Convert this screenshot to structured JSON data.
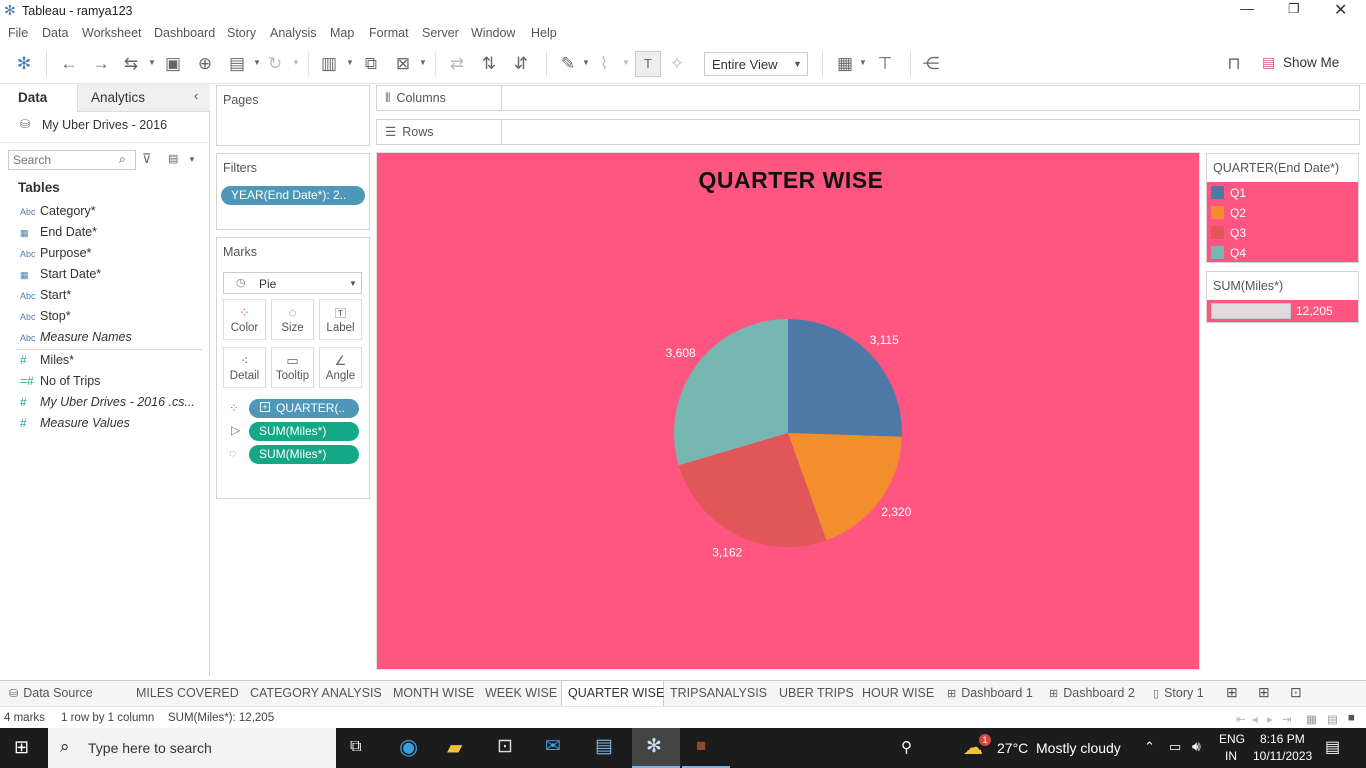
{
  "window": {
    "title": "Tableau - ramya123"
  },
  "menu": [
    "File",
    "Data",
    "Worksheet",
    "Dashboard",
    "Story",
    "Analysis",
    "Map",
    "Format",
    "Server",
    "Window",
    "Help"
  ],
  "toolbar": {
    "view_select": "Entire View",
    "show_me": "Show Me"
  },
  "left_panel": {
    "tab_data": "Data",
    "tab_analytics": "Analytics",
    "datasource": "My Uber Drives - 2016",
    "search_placeholder": "Search",
    "tables_header": "Tables",
    "fields": [
      {
        "name": "Category*",
        "icon": "Abc",
        "italic": false
      },
      {
        "name": "End Date*",
        "icon": "date",
        "italic": false
      },
      {
        "name": "Purpose*",
        "icon": "Abc",
        "italic": false
      },
      {
        "name": "Start Date*",
        "icon": "date",
        "italic": false
      },
      {
        "name": "Start*",
        "icon": "Abc",
        "italic": false
      },
      {
        "name": "Stop*",
        "icon": "Abc",
        "italic": false
      },
      {
        "name": "Measure Names",
        "icon": "Abc",
        "italic": true
      },
      {
        "name": "Miles*",
        "icon": "#",
        "italic": false
      },
      {
        "name": "No of Trips",
        "icon": "=#",
        "italic": false
      },
      {
        "name": "My Uber Drives - 2016 .cs...",
        "icon": "#",
        "italic": true
      },
      {
        "name": "Measure Values",
        "icon": "#",
        "italic": true
      }
    ]
  },
  "pages": {
    "title": "Pages"
  },
  "filters": {
    "title": "Filters",
    "pill": "YEAR(End Date*): 2.."
  },
  "marks": {
    "title": "Marks",
    "type": "Pie",
    "buttons": [
      "Color",
      "Size",
      "Label",
      "Detail",
      "Tooltip",
      "Angle"
    ],
    "pills": [
      {
        "label": "QUARTER(..",
        "color": "#4f97b8"
      },
      {
        "label": "SUM(Miles*)",
        "color": "#14a887"
      },
      {
        "label": "SUM(Miles*)",
        "color": "#14a887"
      }
    ]
  },
  "shelves": {
    "columns": "Columns",
    "rows": "Rows"
  },
  "viz": {
    "title": "QUARTER WISE",
    "background": "#fe5680"
  },
  "chart_data": {
    "type": "pie",
    "title": "QUARTER WISE",
    "categories": [
      "Q1",
      "Q2",
      "Q3",
      "Q4"
    ],
    "values": [
      3115,
      2320,
      3162,
      3608
    ],
    "value_labels": [
      "3,115",
      "2,320",
      "3,162",
      "3,608"
    ],
    "colors": [
      "#4e79a7",
      "#f28e2b",
      "#e15759",
      "#76b7b2"
    ],
    "legend_position": "right"
  },
  "legend_color": {
    "title": "QUARTER(End Date*)"
  },
  "legend_size": {
    "title": "SUM(Miles*)",
    "value": "12,205"
  },
  "tabs": [
    {
      "label": "Data Source",
      "icon": "db"
    },
    {
      "label": "MILES COVERED"
    },
    {
      "label": "CATEGORY ANALYSIS"
    },
    {
      "label": "MONTH WISE"
    },
    {
      "label": "WEEK WISE"
    },
    {
      "label": "QUARTER WISE",
      "active": true
    },
    {
      "label": "TRIPSANALYSIS"
    },
    {
      "label": "UBER TRIPS"
    },
    {
      "label": "HOUR WISE"
    },
    {
      "label": "Dashboard 1",
      "icon": "grid"
    },
    {
      "label": "Dashboard 2",
      "icon": "grid"
    },
    {
      "label": "Story 1",
      "icon": "story"
    }
  ],
  "status": {
    "marks": "4 marks",
    "layout": "1 row by 1 column",
    "sum": "SUM(Miles*): 12,205"
  },
  "taskbar": {
    "search_placeholder": "Type here to search",
    "weather_temp": "27°C",
    "weather_text": "Mostly cloudy",
    "weather_badge": "1",
    "lang": "ENG",
    "region": "IN",
    "time": "8:16 PM",
    "date": "10/11/2023"
  }
}
